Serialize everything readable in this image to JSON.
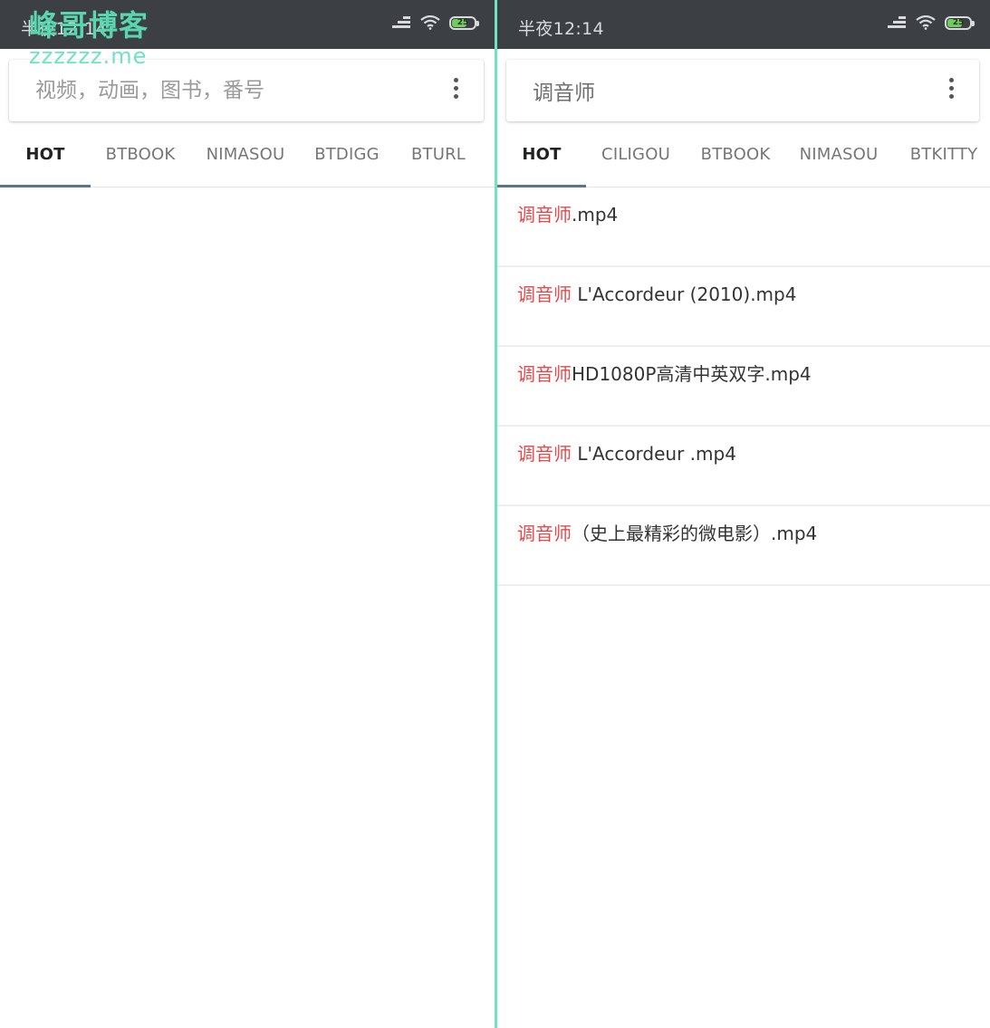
{
  "watermark": {
    "title": "峰哥博客",
    "subtitle": "zzzzzz.me"
  },
  "left_panel": {
    "status": {
      "time": "半夜12:14",
      "battery": "25"
    },
    "search": {
      "placeholder": "视频，动画，图书，番号",
      "value": ""
    },
    "tabs": [
      {
        "label": "HOT",
        "active": true
      },
      {
        "label": "BTBOOK",
        "active": false
      },
      {
        "label": "NIMASOU",
        "active": false
      },
      {
        "label": "BTDIGG",
        "active": false
      },
      {
        "label": "BTURL",
        "active": false
      }
    ],
    "results": []
  },
  "right_panel": {
    "status": {
      "time": "半夜12:14",
      "battery": "25"
    },
    "search": {
      "placeholder": "",
      "value": "调音师"
    },
    "tabs": [
      {
        "label": "HOT",
        "active": true
      },
      {
        "label": "CILIGOU",
        "active": false
      },
      {
        "label": "BTBOOK",
        "active": false
      },
      {
        "label": "NIMASOU",
        "active": false
      },
      {
        "label": "BTKITTY",
        "active": false
      }
    ],
    "results": [
      {
        "highlight": "调音师",
        "rest": ".mp4"
      },
      {
        "highlight": "调音师",
        "rest": " L'Accordeur (2010).mp4"
      },
      {
        "highlight": "调音师",
        "rest": "HD1080P高清中英双字.mp4"
      },
      {
        "highlight": "调音师",
        "rest": " L'Accordeur .mp4"
      },
      {
        "highlight": "调音师",
        "rest": "（史上最精彩的微电影）.mp4"
      }
    ]
  },
  "colors": {
    "status_bar": "#3c4045",
    "divider": "#6fe3c4",
    "highlight": "#e84848",
    "tab_indicator": "#5a7785",
    "watermark": "#59d6ad"
  }
}
